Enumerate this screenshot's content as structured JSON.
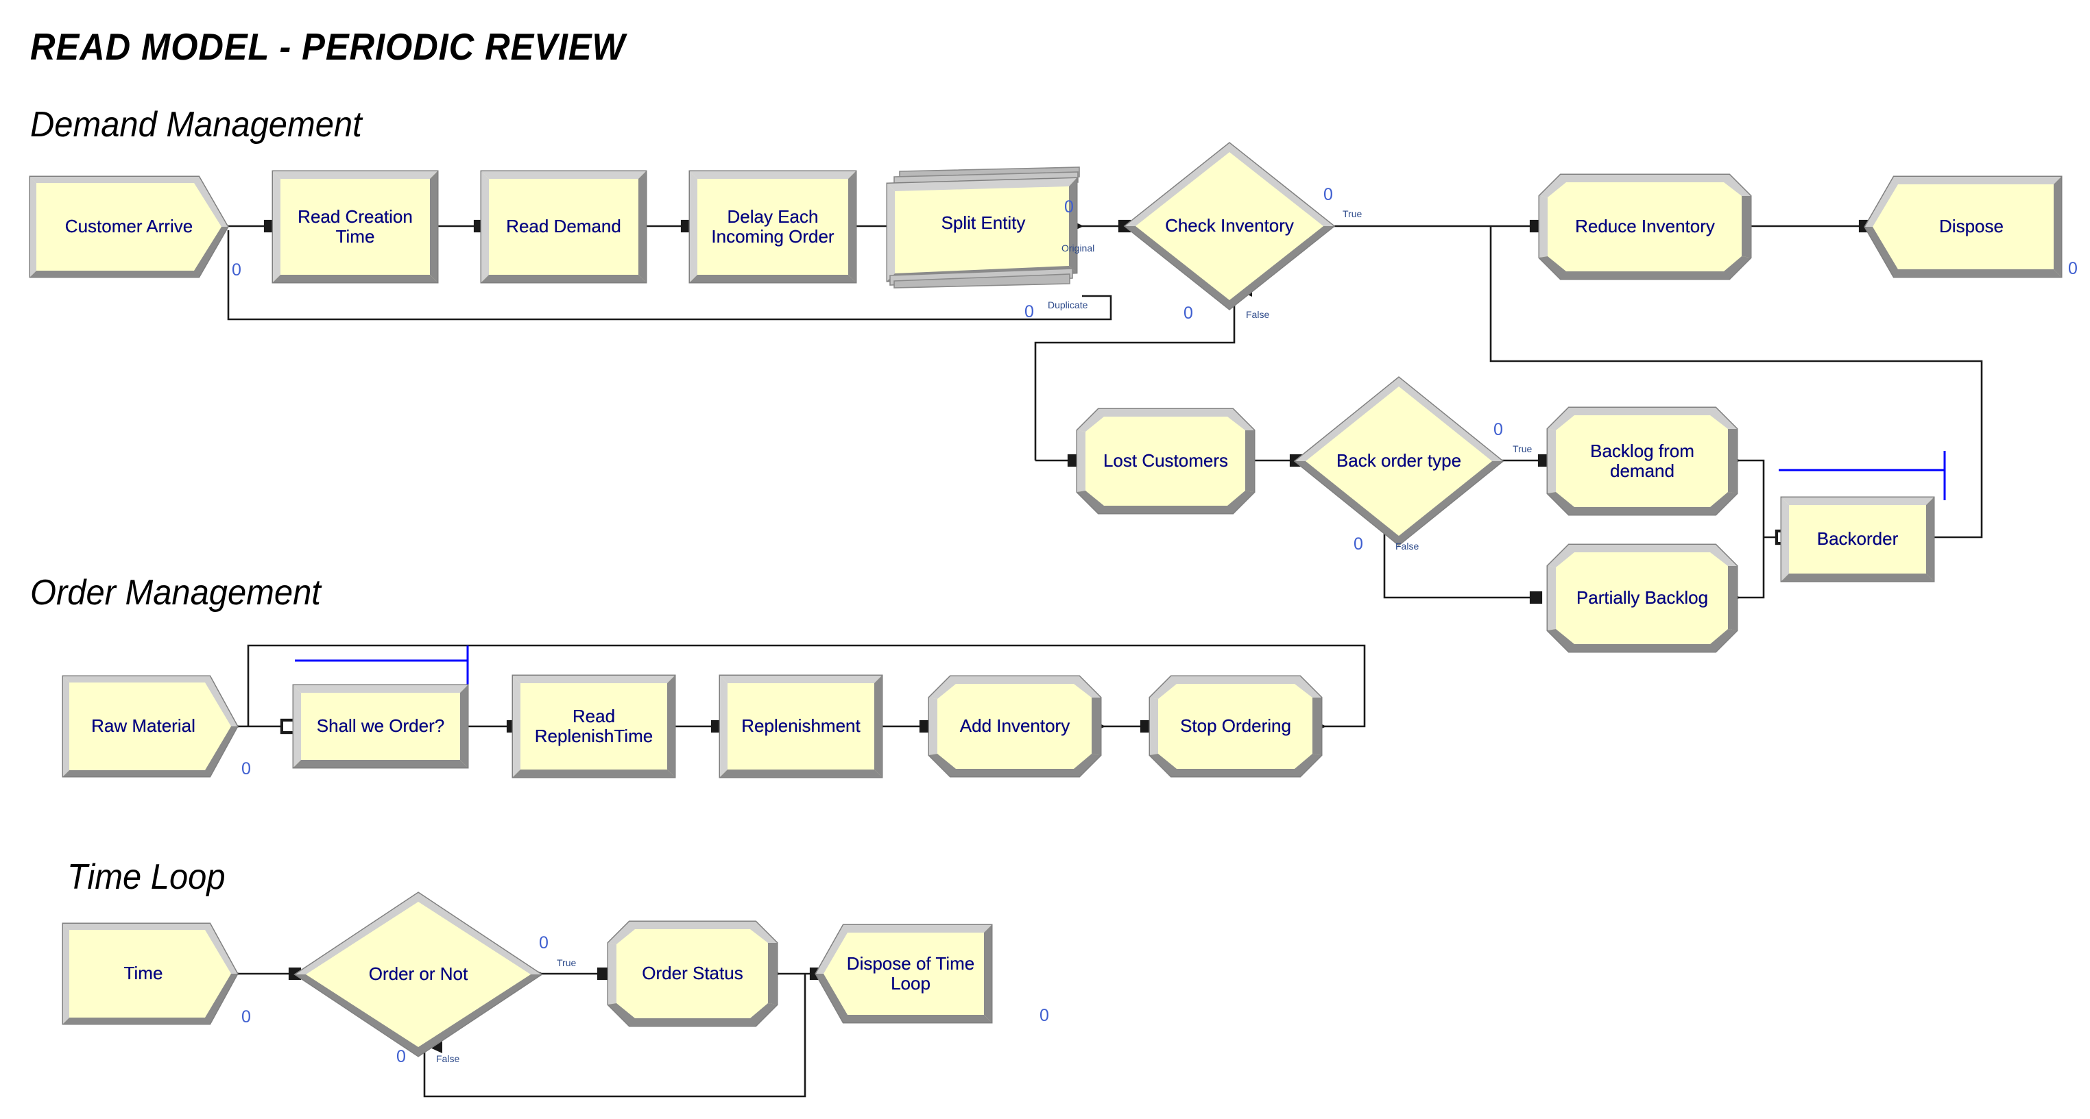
{
  "title": "READ MODEL - PERIODIC REVIEW",
  "sections": [
    {
      "id": "demand",
      "label": "Demand Management"
    },
    {
      "id": "order",
      "label": "Order Management"
    },
    {
      "id": "time",
      "label": "Time Loop"
    }
  ],
  "colors": {
    "shape_fill": "#FFFFCC",
    "shape_border_light": "#C8C8C8",
    "shape_border_dark": "#808080",
    "label_text": "#000080",
    "counter_text": "#3F5FD0",
    "port_text": "#2D4A8A",
    "connector": "#1A1A1A",
    "queue_line": "#0000FF",
    "background": "#FFFFFF"
  },
  "nodes": [
    {
      "id": "customer-arrive",
      "label": "Customer Arrive",
      "shape": "create",
      "section": "demand"
    },
    {
      "id": "read-creation-time",
      "label": "Read Creation\nTime",
      "shape": "process",
      "section": "demand"
    },
    {
      "id": "read-demand",
      "label": "Read Demand",
      "shape": "process",
      "section": "demand"
    },
    {
      "id": "delay-each-incoming-order",
      "label": "Delay Each\nIncoming Order",
      "shape": "process",
      "section": "demand"
    },
    {
      "id": "split-entity",
      "label": "Split Entity",
      "shape": "separate",
      "section": "demand"
    },
    {
      "id": "check-inventory",
      "label": "Check Inventory",
      "shape": "decide",
      "section": "demand"
    },
    {
      "id": "reduce-inventory",
      "label": "Reduce Inventory",
      "shape": "assign",
      "section": "demand"
    },
    {
      "id": "dispose",
      "label": "Dispose",
      "shape": "dispose",
      "section": "demand"
    },
    {
      "id": "lost-customers",
      "label": "Lost Customers",
      "shape": "assign",
      "section": "demand"
    },
    {
      "id": "back-order-type",
      "label": "Back order type",
      "shape": "decide",
      "section": "demand"
    },
    {
      "id": "backlog-from-demand",
      "label": "Backlog from\ndemand",
      "shape": "assign",
      "section": "demand"
    },
    {
      "id": "partially-backlog",
      "label": "Partially Backlog",
      "shape": "assign",
      "section": "demand"
    },
    {
      "id": "backorder",
      "label": "Backorder",
      "shape": "hold",
      "section": "demand"
    },
    {
      "id": "raw-material",
      "label": "Raw Material",
      "shape": "create",
      "section": "order"
    },
    {
      "id": "shall-we-order",
      "label": "Shall we Order?",
      "shape": "hold",
      "section": "order"
    },
    {
      "id": "read-replenishtime",
      "label": "Read\nReplenishTime",
      "shape": "process",
      "section": "order"
    },
    {
      "id": "replenishment",
      "label": "Replenishment",
      "shape": "process",
      "section": "order"
    },
    {
      "id": "add-inventory",
      "label": "Add Inventory",
      "shape": "assign",
      "section": "order"
    },
    {
      "id": "stop-ordering",
      "label": "Stop Ordering",
      "shape": "assign",
      "section": "order"
    },
    {
      "id": "time",
      "label": "Time",
      "shape": "create",
      "section": "time"
    },
    {
      "id": "order-or-not",
      "label": "Order or Not",
      "shape": "decide",
      "section": "time"
    },
    {
      "id": "order-status",
      "label": "Order Status",
      "shape": "assign",
      "section": "time"
    },
    {
      "id": "dispose-of-time-loop",
      "label": "Dispose of Time\nLoop",
      "shape": "dispose",
      "section": "time"
    }
  ],
  "counters": [
    {
      "for": "customer-arrive",
      "value": "0"
    },
    {
      "for": "split-entity-original",
      "value": "0"
    },
    {
      "for": "split-entity-duplicate",
      "value": "0"
    },
    {
      "for": "check-inventory-true",
      "value": "0"
    },
    {
      "for": "check-inventory-false",
      "value": "0"
    },
    {
      "for": "dispose",
      "value": "0"
    },
    {
      "for": "back-order-type-true",
      "value": "0"
    },
    {
      "for": "back-order-type-false",
      "value": "0"
    },
    {
      "for": "raw-material",
      "value": "0"
    },
    {
      "for": "time",
      "value": "0"
    },
    {
      "for": "order-or-not-true",
      "value": "0"
    },
    {
      "for": "order-or-not-false",
      "value": "0"
    },
    {
      "for": "dispose-of-time-loop",
      "value": "0"
    }
  ],
  "port_labels": [
    {
      "for": "split-entity-original",
      "text": "Original"
    },
    {
      "for": "split-entity-duplicate",
      "text": "Duplicate"
    },
    {
      "for": "check-inventory-true",
      "text": "True"
    },
    {
      "for": "check-inventory-false",
      "text": "False"
    },
    {
      "for": "back-order-type-true",
      "text": "True"
    },
    {
      "for": "back-order-type-false",
      "text": "False"
    },
    {
      "for": "order-or-not-true",
      "text": "True"
    },
    {
      "for": "order-or-not-false",
      "text": "False"
    }
  ]
}
